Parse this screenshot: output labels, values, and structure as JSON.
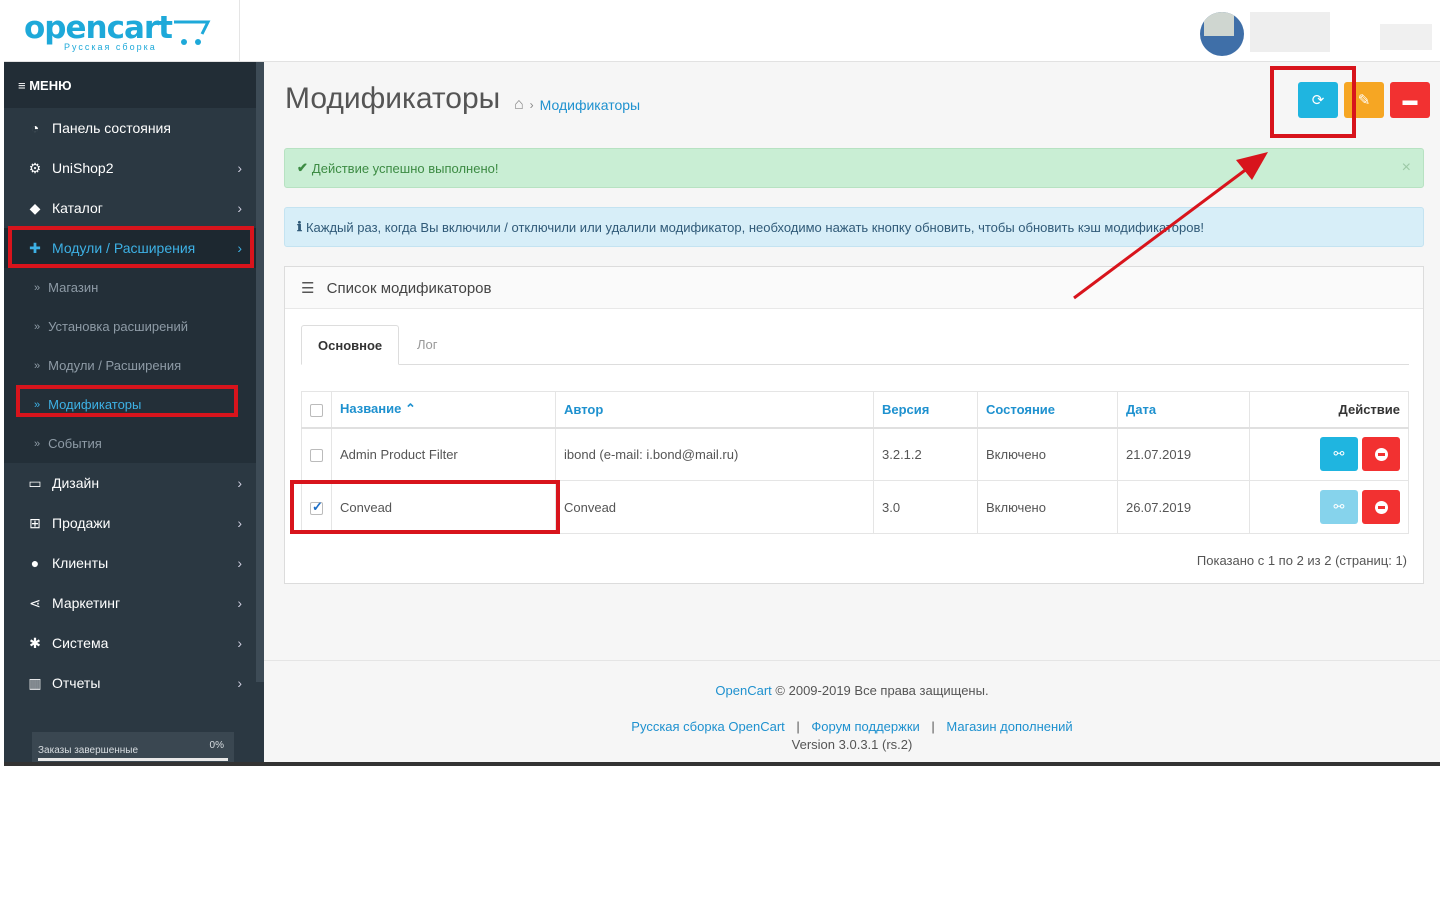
{
  "header": {
    "logo_text": "opencart",
    "logo_subtitle": "Русская сборка"
  },
  "sidebar": {
    "menu_label": "МЕНЮ",
    "items": [
      {
        "label": "Панель состояния",
        "icon": "dashboard-icon"
      },
      {
        "label": "UniShop2",
        "icon": "cogs-icon"
      },
      {
        "label": "Каталог",
        "icon": "tags-icon"
      },
      {
        "label": "Модули / Расширения",
        "icon": "puzzle-icon"
      },
      {
        "label": "Дизайн",
        "icon": "monitor-icon"
      },
      {
        "label": "Продажи",
        "icon": "cart-icon"
      },
      {
        "label": "Клиенты",
        "icon": "user-icon"
      },
      {
        "label": "Маркетинг",
        "icon": "share-icon"
      },
      {
        "label": "Система",
        "icon": "gear-icon"
      },
      {
        "label": "Отчеты",
        "icon": "bar-chart-icon"
      }
    ],
    "sub_items": [
      {
        "label": "Магазин"
      },
      {
        "label": "Установка расширений"
      },
      {
        "label": "Модули / Расширения"
      },
      {
        "label": "Модификаторы"
      },
      {
        "label": "События"
      }
    ],
    "progress": {
      "label": "Заказы завершенные",
      "value": "0%"
    }
  },
  "main": {
    "title": "Модификаторы",
    "breadcrumb": {
      "current": "Модификаторы"
    },
    "alerts": {
      "success": "Действие успешно выполнено!",
      "info": "Каждый раз, когда Вы включили / отключили или удалили модификатор, необходимо нажать кнопку обновить, чтобы обновить кэш модификаторов!"
    },
    "panel_title": "Список модификаторов",
    "tabs": {
      "main": "Основное",
      "log": "Лог"
    },
    "table": {
      "headers": {
        "name": "Название",
        "author": "Автор",
        "version": "Версия",
        "status": "Состояние",
        "date": "Дата",
        "action": "Действие"
      },
      "rows": [
        {
          "name": "Admin Product Filter",
          "author": "ibond (e-mail: i.bond@mail.ru)",
          "version": "3.2.1.2",
          "status": "Включено",
          "date": "21.07.2019",
          "checked": false
        },
        {
          "name": "Convead",
          "author": "Convead",
          "version": "3.0",
          "status": "Включено",
          "date": "26.07.2019",
          "checked": true
        }
      ]
    },
    "pagination_text": "Показано с 1 по 2 из 2 (страниц: 1)"
  },
  "footer": {
    "brand_link": "OpenCart",
    "copyright": "© 2009-2019 Все права защищены.",
    "links": [
      "Русская сборка OpenCart",
      "Форум поддержки",
      "Магазин дополнений"
    ],
    "version": "Version 3.0.3.1 (rs.2)"
  },
  "colors": {
    "accent": "#1e91cf",
    "sidebar": "#2b3842",
    "refresh_button": "#1fb5e0",
    "clear_button": "#f6a623",
    "delete_button": "#f23131",
    "annotation": "#d8141c"
  }
}
